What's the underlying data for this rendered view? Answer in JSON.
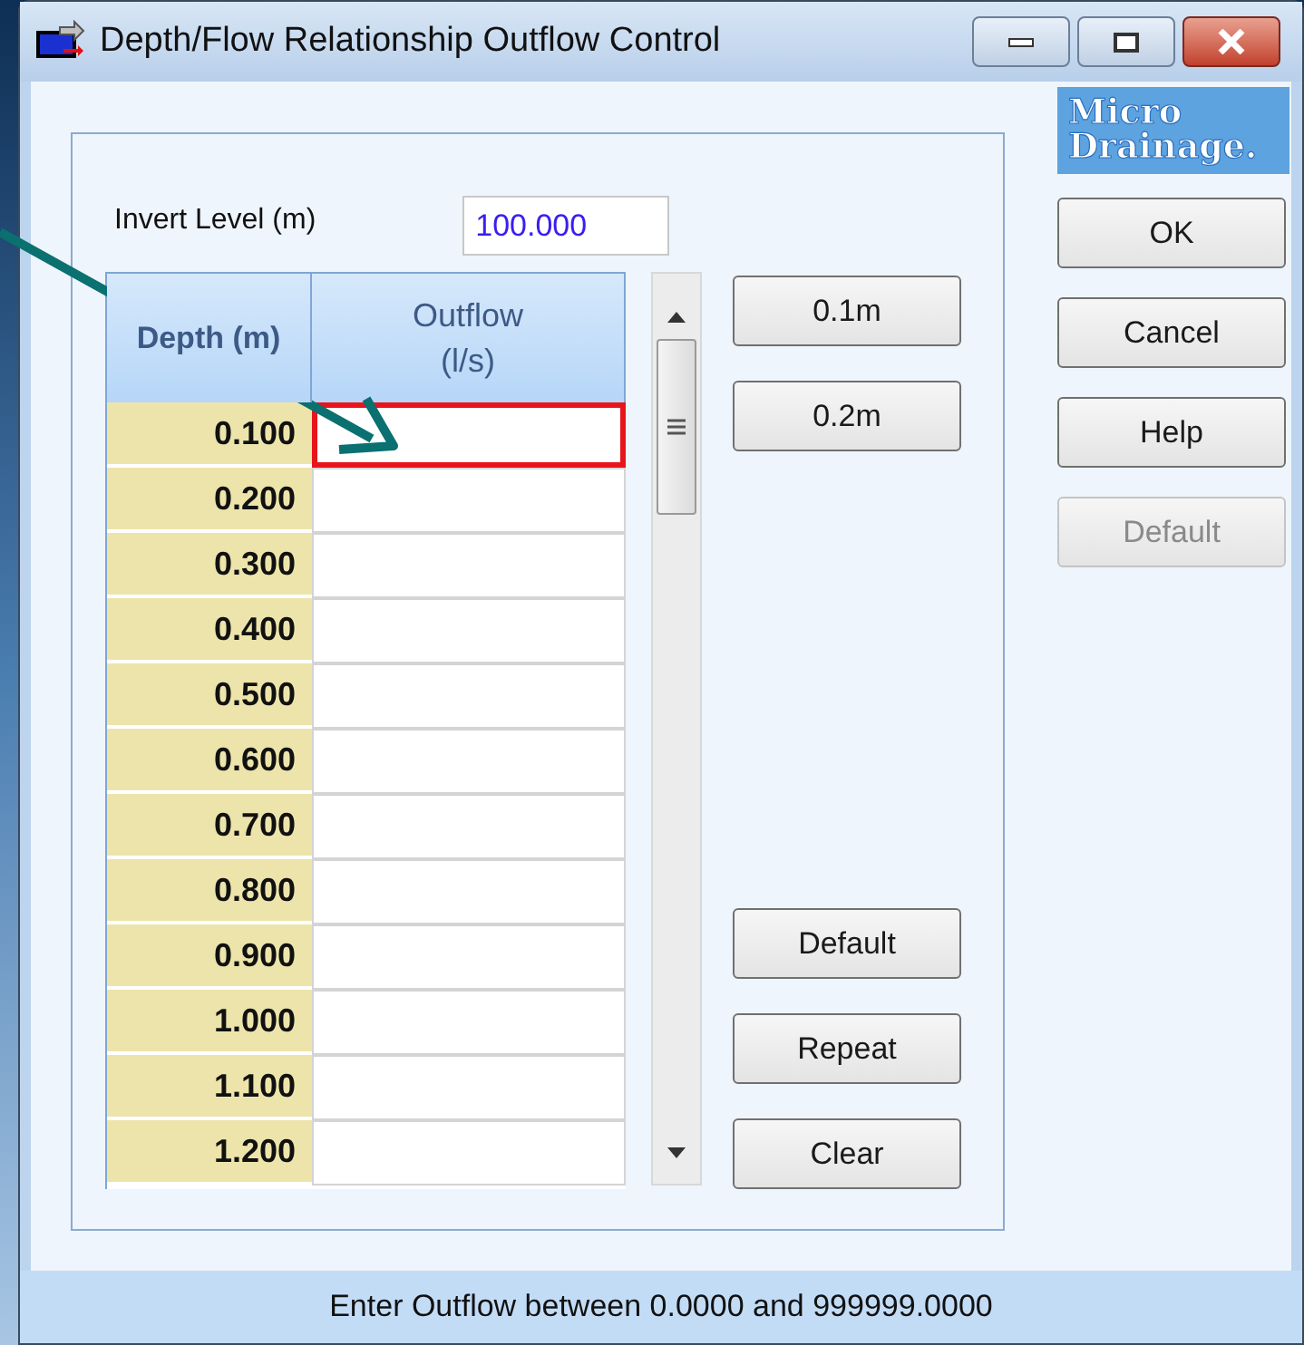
{
  "window": {
    "title": "Depth/Flow Relationship Outflow Control"
  },
  "invert_level": {
    "label": "Invert Level (m)",
    "value": "100.000"
  },
  "table": {
    "columns": [
      "Depth (m)",
      "Outflow\n(l/s)"
    ],
    "rows": [
      {
        "depth": "0.100",
        "selected": true
      },
      {
        "depth": "0.200",
        "selected": false
      },
      {
        "depth": "0.300",
        "selected": false
      },
      {
        "depth": "0.400",
        "selected": false
      },
      {
        "depth": "0.500",
        "selected": false
      },
      {
        "depth": "0.600",
        "selected": false
      },
      {
        "depth": "0.700",
        "selected": false
      },
      {
        "depth": "0.800",
        "selected": false
      },
      {
        "depth": "0.900",
        "selected": false
      },
      {
        "depth": "1.000",
        "selected": false
      },
      {
        "depth": "1.100",
        "selected": false
      },
      {
        "depth": "1.200",
        "selected": false
      }
    ]
  },
  "step_buttons": [
    "0.1m",
    "0.2m"
  ],
  "table_buttons": [
    "Default",
    "Repeat",
    "Clear"
  ],
  "logo": [
    "Micro",
    "Drainage."
  ],
  "dialog_buttons": [
    {
      "label": "OK",
      "disabled": false
    },
    {
      "label": "Cancel",
      "disabled": false
    },
    {
      "label": "Help",
      "disabled": false
    },
    {
      "label": "Default",
      "disabled": true
    }
  ],
  "status_bar": "Enter Outflow between 0.0000 and 999999.0000"
}
